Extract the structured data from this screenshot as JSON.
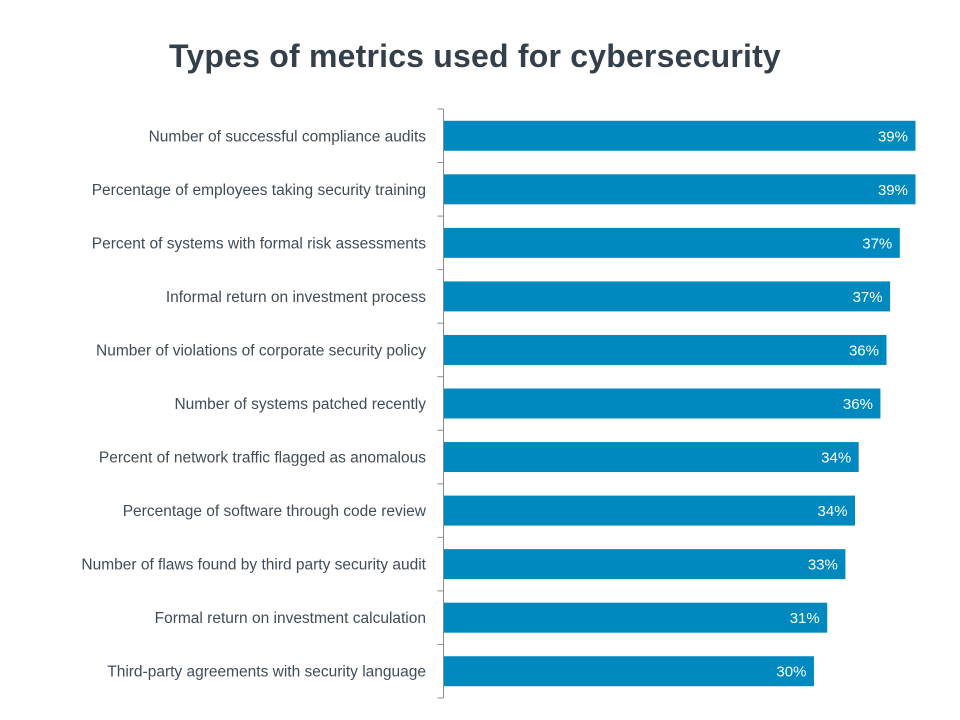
{
  "chart_data": {
    "type": "bar",
    "orientation": "horizontal",
    "title": "Types of metrics used for cybersecurity",
    "xlabel": "",
    "ylabel": "",
    "xlim": [
      0,
      39
    ],
    "grid": false,
    "legend": "none",
    "bar_color": "#0089bf",
    "categories": [
      "Number of successful compliance audits",
      "Percentage of employees taking security training",
      "Percent of systems with formal risk assessments",
      "Informal return on investment process",
      "Number of violations of corporate security policy",
      "Number of systems patched recently",
      "Percent of network traffic flagged as anomalous",
      "Percentage of software through code review",
      "Number of flaws found by third party security audit",
      "Formal return on investment calculation",
      "Third-party agreements with security language"
    ],
    "values": [
      39.0,
      39.0,
      37.7,
      36.9,
      36.6,
      36.1,
      34.3,
      34.0,
      33.2,
      31.7,
      30.6
    ],
    "data_labels": [
      "39%",
      "39%",
      "37%",
      "37%",
      "36%",
      "36%",
      "34%",
      "34%",
      "33%",
      "31%",
      "30%"
    ]
  }
}
